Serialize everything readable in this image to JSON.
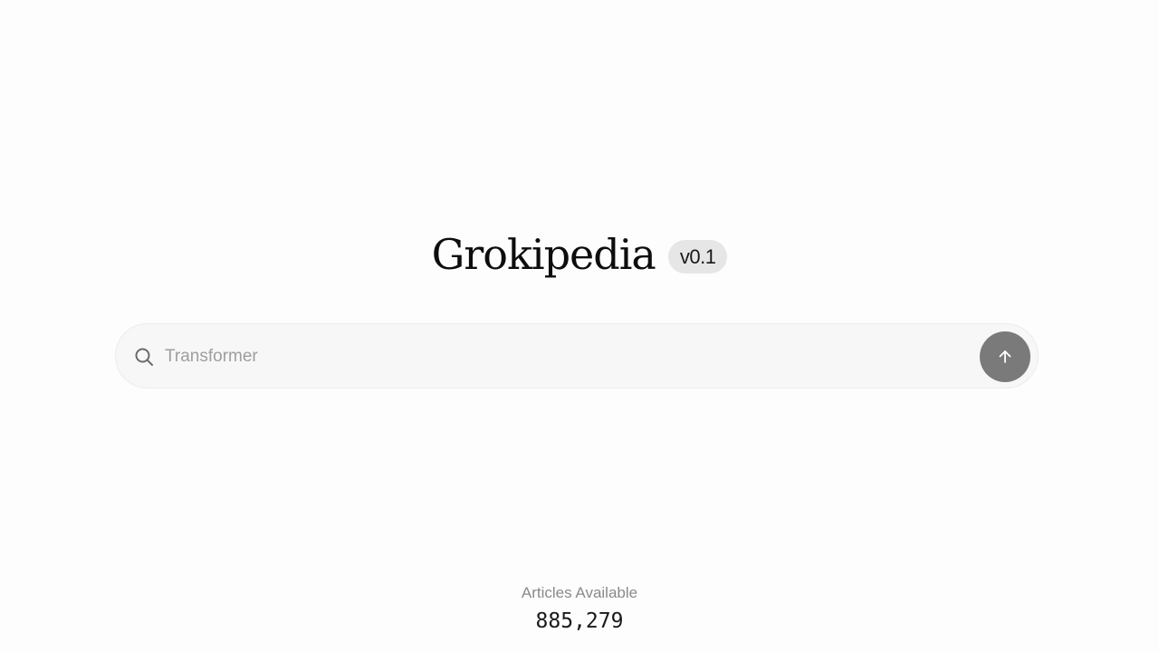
{
  "brand": {
    "title": "Grokipedia",
    "version": "v0.1"
  },
  "search": {
    "placeholder": "Transformer",
    "value": "",
    "icon": "search-icon",
    "submit_icon": "arrow-up-icon"
  },
  "stats": {
    "label": "Articles Available",
    "count": "885,279"
  },
  "colors": {
    "background": "#fdfdfd",
    "search_bg": "#f7f7f7",
    "submit_button": "#7a7a7a",
    "badge_bg": "#e6e6e6"
  }
}
